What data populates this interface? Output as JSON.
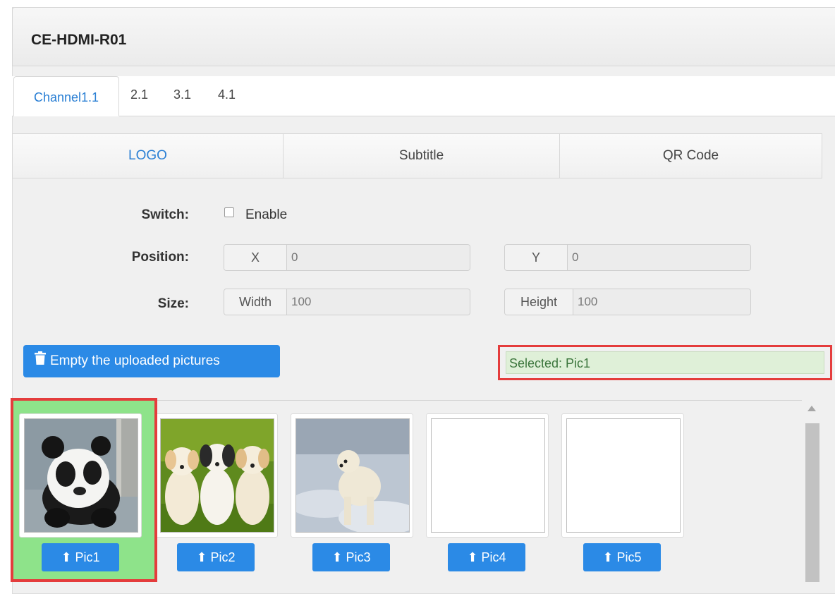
{
  "device": {
    "title": "CE-HDMI-R01"
  },
  "channel_tabs": [
    {
      "label": "Channel1.1",
      "active": true
    },
    {
      "label": "2.1",
      "active": false
    },
    {
      "label": "3.1",
      "active": false
    },
    {
      "label": "4.1",
      "active": false
    }
  ],
  "function_tabs": [
    {
      "label": "LOGO",
      "active": true
    },
    {
      "label": "Subtitle",
      "active": false
    },
    {
      "label": "QR Code",
      "active": false
    }
  ],
  "form": {
    "switch_label": "Switch:",
    "enable_label": "Enable",
    "enable_checked": false,
    "position_label": "Position:",
    "x_label": "X",
    "x_value": "0",
    "y_label": "Y",
    "y_value": "0",
    "size_label": "Size:",
    "width_label": "Width",
    "width_value": "100",
    "height_label": "Height",
    "height_value": "100"
  },
  "actions": {
    "empty_label": "Empty the uploaded pictures",
    "selected_text": "Selected: Pic1"
  },
  "pictures": [
    {
      "label": "Pic1",
      "content": "panda",
      "selected": true
    },
    {
      "label": "Pic2",
      "content": "puppies",
      "selected": false
    },
    {
      "label": "Pic3",
      "content": "polar-bear",
      "selected": false
    },
    {
      "label": "Pic4",
      "content": "empty",
      "selected": false
    },
    {
      "label": "Pic5",
      "content": "empty",
      "selected": false
    }
  ],
  "colors": {
    "accent": "#2b8ae6",
    "highlight": "#e43c3c",
    "selected_bg": "#8ee38a",
    "success_bg": "#dff0d8"
  }
}
